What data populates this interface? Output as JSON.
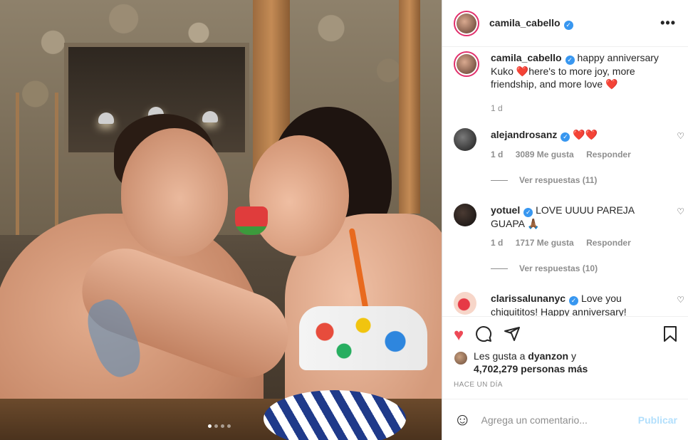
{
  "post": {
    "photo_alt": "",
    "slide_count": 4,
    "active_slide": 0
  },
  "header": {
    "username": "camila_cabello",
    "verified_icon": "verified-badge-icon",
    "more_label": "•••"
  },
  "caption": {
    "username": "camila_cabello",
    "text": "happy anniversary Kuko ❤️here's to more joy, more friendship, and more love ❤️",
    "time": "1 d"
  },
  "comments": [
    {
      "username": "alejandrosanz",
      "text": "❤️❤️",
      "time": "1 d",
      "likes": "3089 Me gusta",
      "reply_label": "Responder",
      "replies": "Ver respuestas (11)"
    },
    {
      "username": "yotuel",
      "text": "LOVE UUUU PAREJA GUAPA 🙏🏾",
      "time": "1 d",
      "likes": "1717 Me gusta",
      "reply_label": "Responder",
      "replies": "Ver respuestas (10)"
    },
    {
      "username": "clarissalunanyc",
      "text": "Love you chiquititos! Happy anniversary!"
    }
  ],
  "actions": {
    "likes_prefix": "Les gusta a",
    "liked_by": "dyanzon",
    "likes_connector": "y",
    "likes_count": "4,702,279 personas más",
    "posted": "HACE UN DÍA"
  },
  "add_comment": {
    "placeholder": "Agrega un comentario...",
    "publish_label": "Publicar"
  },
  "colors": {
    "like": "#ed4956",
    "verified": "#3897f0",
    "publish_disabled": "#b2dffc"
  }
}
